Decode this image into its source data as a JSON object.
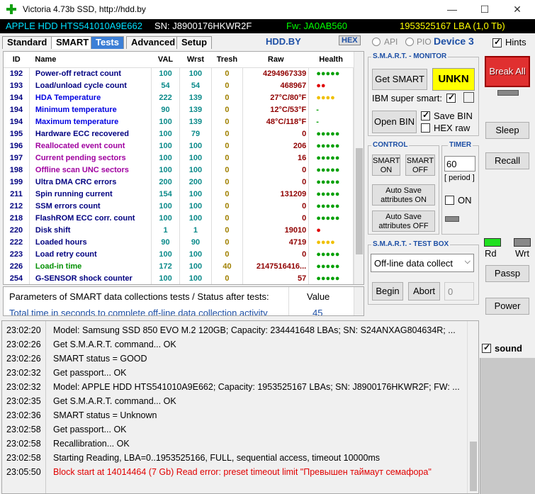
{
  "window": {
    "title": "Victoria 4.73b SSD, http://hdd.by",
    "minimize": "—",
    "maximize": "☐",
    "close": "✕"
  },
  "infobar": {
    "model": "APPLE HDD HTS541010A9E662",
    "sn": "SN: J8900176HKWR2F",
    "fw": "Fw: JA0AB560",
    "lba": "1953525167 LBA (1,0 Tb)"
  },
  "tabs": [
    {
      "label": "Standard"
    },
    {
      "label": "SMART"
    },
    {
      "label": "Tests"
    },
    {
      "label": "Advanced"
    },
    {
      "label": "Setup"
    }
  ],
  "tabrow": {
    "site": "HDD.BY",
    "hex": "HEX",
    "api": "API",
    "pio": "PIO",
    "device": "Device 3",
    "hints": "Hints"
  },
  "smart": {
    "headers": [
      "ID",
      "Name",
      "VAL",
      "Wrst",
      "Tresh",
      "Raw",
      "Health"
    ],
    "rows": [
      {
        "id": "192",
        "name": "Power-off retract count",
        "val": "100",
        "wrst": "100",
        "tresh": "0",
        "raw": "4294967339",
        "health": "●●●●●",
        "nameColor": "#000080",
        "healthColor": "#00a000"
      },
      {
        "id": "193",
        "name": "Load/unload cycle count",
        "val": "54",
        "wrst": "54",
        "tresh": "0",
        "raw": "468967",
        "health": "●●",
        "nameColor": "#000080",
        "healthColor": "#e00000"
      },
      {
        "id": "194",
        "name": "HDA Temperature",
        "val": "222",
        "wrst": "139",
        "tresh": "0",
        "raw": "27°C/80°F",
        "health": "●●●●",
        "nameColor": "#0000e0",
        "healthColor": "#f0c000"
      },
      {
        "id": "194",
        "name": "Minimum temperature",
        "val": "90",
        "wrst": "139",
        "tresh": "0",
        "raw": "12°C/53°F",
        "health": "-",
        "nameColor": "#0000e0",
        "healthColor": "#00a000"
      },
      {
        "id": "194",
        "name": "Maximum temperature",
        "val": "100",
        "wrst": "139",
        "tresh": "0",
        "raw": "48°C/118°F",
        "health": "-",
        "nameColor": "#0000e0",
        "healthColor": "#00a000"
      },
      {
        "id": "195",
        "name": "Hardware ECC recovered",
        "val": "100",
        "wrst": "79",
        "tresh": "0",
        "raw": "0",
        "health": "●●●●●",
        "nameColor": "#000080",
        "healthColor": "#00a000"
      },
      {
        "id": "196",
        "name": "Reallocated event count",
        "val": "100",
        "wrst": "100",
        "tresh": "0",
        "raw": "206",
        "health": "●●●●●",
        "nameColor": "#a000a0",
        "healthColor": "#00a000"
      },
      {
        "id": "197",
        "name": "Current pending sectors",
        "val": "100",
        "wrst": "100",
        "tresh": "0",
        "raw": "16",
        "health": "●●●●●",
        "nameColor": "#a000a0",
        "healthColor": "#00a000"
      },
      {
        "id": "198",
        "name": "Offline scan UNC sectors",
        "val": "100",
        "wrst": "100",
        "tresh": "0",
        "raw": "0",
        "health": "●●●●●",
        "nameColor": "#a000a0",
        "healthColor": "#00a000"
      },
      {
        "id": "199",
        "name": "Ultra DMA CRC errors",
        "val": "200",
        "wrst": "200",
        "tresh": "0",
        "raw": "0",
        "health": "●●●●●",
        "nameColor": "#000080",
        "healthColor": "#00a000"
      },
      {
        "id": "211",
        "name": "Spin running current",
        "val": "154",
        "wrst": "100",
        "tresh": "0",
        "raw": "131209",
        "health": "●●●●●",
        "nameColor": "#000080",
        "healthColor": "#00a000"
      },
      {
        "id": "212",
        "name": "SSM errors count",
        "val": "100",
        "wrst": "100",
        "tresh": "0",
        "raw": "0",
        "health": "●●●●●",
        "nameColor": "#000080",
        "healthColor": "#00a000"
      },
      {
        "id": "218",
        "name": "FlashROM ECC corr. count",
        "val": "100",
        "wrst": "100",
        "tresh": "0",
        "raw": "0",
        "health": "●●●●●",
        "nameColor": "#000080",
        "healthColor": "#00a000"
      },
      {
        "id": "220",
        "name": "Disk shift",
        "val": "1",
        "wrst": "1",
        "tresh": "0",
        "raw": "19010",
        "health": "●",
        "nameColor": "#000080",
        "healthColor": "#e00000"
      },
      {
        "id": "222",
        "name": "Loaded hours",
        "val": "90",
        "wrst": "90",
        "tresh": "0",
        "raw": "4719",
        "health": "●●●●",
        "nameColor": "#000080",
        "healthColor": "#f0c000"
      },
      {
        "id": "223",
        "name": "Load retry count",
        "val": "100",
        "wrst": "100",
        "tresh": "0",
        "raw": "0",
        "health": "●●●●●",
        "nameColor": "#000080",
        "healthColor": "#00a000"
      },
      {
        "id": "226",
        "name": "Load-in time",
        "val": "172",
        "wrst": "100",
        "tresh": "40",
        "raw": "2147516416...",
        "health": "●●●●●",
        "nameColor": "#009000",
        "healthColor": "#00a000"
      },
      {
        "id": "254",
        "name": "G-SENSOR shock counter",
        "val": "100",
        "wrst": "100",
        "tresh": "0",
        "raw": "57",
        "health": "●●●●●",
        "nameColor": "#000080",
        "healthColor": "#00a000"
      }
    ]
  },
  "params": {
    "header": "Parameters of SMART data collections tests / Status after tests:",
    "value_header": "Value",
    "row_label": "Total time in seconds to complete off-line data collection activity",
    "row_value": "45"
  },
  "monitor": {
    "title": "S.M.A.R.T. - MONITOR",
    "get_smart": "Get SMART",
    "status": "UNKN",
    "ibm": "IBM super smart:",
    "open_bin": "Open BIN",
    "save_bin": "Save BIN",
    "hex_raw": "HEX raw"
  },
  "control": {
    "title": "CONTROL",
    "smart_on": "SMART ON",
    "smart_off": "SMART OFF",
    "autosave_on": "Auto Save attributes ON",
    "autosave_off": "Auto Save attributes OFF"
  },
  "timer": {
    "title": "TIMER",
    "value": "60",
    "period": "[ period ]",
    "on": "ON"
  },
  "testbox": {
    "title": "S.M.A.R.T. - TEST BOX",
    "select": "Off-line data collect",
    "begin": "Begin",
    "abort": "Abort",
    "value": "0"
  },
  "right": {
    "break_all": "Break All",
    "sleep": "Sleep",
    "recall": "Recall",
    "rd": "Rd",
    "wrt": "Wrt",
    "passp": "Passp",
    "power": "Power",
    "sound": "sound"
  },
  "log": [
    {
      "time": "23:02:20",
      "msg": "Model: Samsung SSD 850 EVO M.2 120GB; Capacity: 234441648 LBAs; SN: S24ANXAG804634R; ...",
      "color": "#000000"
    },
    {
      "time": "23:02:26",
      "msg": "Get S.M.A.R.T. command... OK",
      "color": "#000000"
    },
    {
      "time": "23:02:26",
      "msg": "SMART status = GOOD",
      "color": "#000000"
    },
    {
      "time": "23:02:32",
      "msg": "Get passport... OK",
      "color": "#000000"
    },
    {
      "time": "23:02:32",
      "msg": "Model: APPLE HDD HTS541010A9E662; Capacity: 1953525167 LBAs; SN: J8900176HKWR2F; FW: ...",
      "color": "#000000"
    },
    {
      "time": "23:02:35",
      "msg": "Get S.M.A.R.T. command... OK",
      "color": "#000000"
    },
    {
      "time": "23:02:36",
      "msg": "SMART status = Unknown",
      "color": "#000000"
    },
    {
      "time": "23:02:58",
      "msg": "Get passport... OK",
      "color": "#000000"
    },
    {
      "time": "23:02:58",
      "msg": "Recallibration... OK",
      "color": "#000000"
    },
    {
      "time": "23:02:58",
      "msg": "Starting Reading, LBA=0..1953525166, FULL, sequential access, timeout 10000ms",
      "color": "#000000"
    },
    {
      "time": "23:05:50",
      "msg": "Block start at 14014464 (7 Gb) Read error: preset timeout limit \"Превышен таймаут семафора\"",
      "color": "#e00000"
    }
  ]
}
